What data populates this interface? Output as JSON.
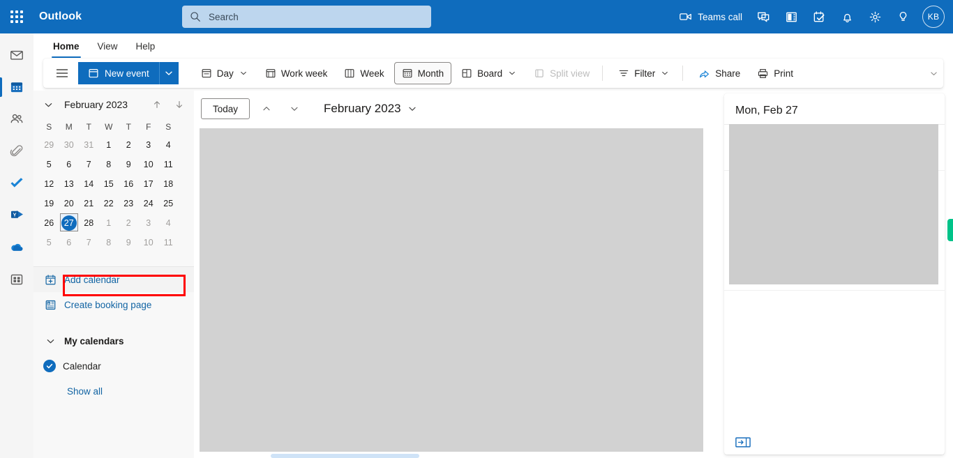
{
  "topbar": {
    "brand": "Outlook",
    "waffle_name": "app-launcher",
    "search": {
      "placeholder": "Search",
      "value": ""
    },
    "teams_call_label": "Teams call",
    "icons": [
      "video-camera-icon",
      "chat-icon",
      "skype-icon",
      "tasks-icon",
      "bell-icon",
      "gear-icon",
      "lightbulb-icon"
    ],
    "avatar_initials": "KB",
    "background_color": "#0f6cbd",
    "search_background": "#bdd6ee"
  },
  "rail": {
    "items": [
      {
        "name": "mail-icon",
        "label": "Mail",
        "selected": false
      },
      {
        "name": "calendar-icon",
        "label": "Calendar",
        "selected": true
      },
      {
        "name": "people-icon",
        "label": "People",
        "selected": false
      },
      {
        "name": "files-icon",
        "label": "Files",
        "selected": false
      },
      {
        "name": "to-do-icon",
        "label": "To Do",
        "selected": false
      },
      {
        "name": "yammer-icon",
        "label": "Yammer",
        "selected": false
      },
      {
        "name": "onedrive-icon",
        "label": "OneDrive",
        "selected": false
      },
      {
        "name": "apps-icon",
        "label": "Apps",
        "selected": false
      }
    ],
    "accent_color": "#0f6cbd"
  },
  "ribbon": {
    "tabs": [
      {
        "label": "Home",
        "active": true
      },
      {
        "label": "View",
        "active": false
      },
      {
        "label": "Help",
        "active": false
      }
    ],
    "overflow_icon": "chevron-down-icon"
  },
  "toolbar": {
    "hamburger_icon": "hamburger-icon",
    "new_event_label": "New event",
    "new_event_icon": "calendar-blank-icon",
    "new_event_caret_icon": "chevron-down-icon",
    "buttons": [
      {
        "label": "Day",
        "icon": "day-view-icon",
        "caret": true,
        "selected": false,
        "disabled": false
      },
      {
        "label": "Work week",
        "icon": "work-week-icon",
        "caret": false,
        "selected": false,
        "disabled": false
      },
      {
        "label": "Week",
        "icon": "week-view-icon",
        "caret": false,
        "selected": false,
        "disabled": false
      },
      {
        "label": "Month",
        "icon": "month-view-icon",
        "caret": false,
        "selected": true,
        "disabled": false
      },
      {
        "label": "Board",
        "icon": "board-view-icon",
        "caret": true,
        "selected": false,
        "disabled": false
      },
      {
        "label": "Split view",
        "icon": "split-view-icon",
        "caret": false,
        "selected": false,
        "disabled": true
      },
      {
        "label": "Filter",
        "icon": "filter-icon",
        "caret": true,
        "selected": false,
        "disabled": false
      },
      {
        "label": "Share",
        "icon": "share-icon",
        "caret": false,
        "selected": false,
        "disabled": false
      },
      {
        "label": "Print",
        "icon": "print-icon",
        "caret": false,
        "selected": false,
        "disabled": false
      }
    ]
  },
  "mini_calendar": {
    "collapse_icon": "chevron-down-icon",
    "title": "February 2023",
    "prev_icon": "arrow-up-icon",
    "next_icon": "arrow-down-icon",
    "day_headers": [
      "S",
      "M",
      "T",
      "W",
      "T",
      "F",
      "S"
    ],
    "weeks": [
      [
        {
          "d": "29",
          "muted": true
        },
        {
          "d": "30",
          "muted": true
        },
        {
          "d": "31",
          "muted": true
        },
        {
          "d": "1",
          "muted": false
        },
        {
          "d": "2",
          "muted": false
        },
        {
          "d": "3",
          "muted": false
        },
        {
          "d": "4",
          "muted": false
        }
      ],
      [
        {
          "d": "5",
          "muted": false
        },
        {
          "d": "6",
          "muted": false
        },
        {
          "d": "7",
          "muted": false
        },
        {
          "d": "8",
          "muted": false
        },
        {
          "d": "9",
          "muted": false
        },
        {
          "d": "10",
          "muted": false
        },
        {
          "d": "11",
          "muted": false
        }
      ],
      [
        {
          "d": "12",
          "muted": false
        },
        {
          "d": "13",
          "muted": false
        },
        {
          "d": "14",
          "muted": false
        },
        {
          "d": "15",
          "muted": false
        },
        {
          "d": "16",
          "muted": false
        },
        {
          "d": "17",
          "muted": false
        },
        {
          "d": "18",
          "muted": false
        }
      ],
      [
        {
          "d": "19",
          "muted": false
        },
        {
          "d": "20",
          "muted": false
        },
        {
          "d": "21",
          "muted": false
        },
        {
          "d": "22",
          "muted": false
        },
        {
          "d": "23",
          "muted": false
        },
        {
          "d": "24",
          "muted": false
        },
        {
          "d": "25",
          "muted": false
        }
      ],
      [
        {
          "d": "26",
          "muted": false
        },
        {
          "d": "27",
          "muted": false,
          "today": true
        },
        {
          "d": "28",
          "muted": false
        },
        {
          "d": "1",
          "muted": true
        },
        {
          "d": "2",
          "muted": true
        },
        {
          "d": "3",
          "muted": true
        },
        {
          "d": "4",
          "muted": true
        }
      ],
      [
        {
          "d": "5",
          "muted": true
        },
        {
          "d": "6",
          "muted": true
        },
        {
          "d": "7",
          "muted": true
        },
        {
          "d": "8",
          "muted": true
        },
        {
          "d": "9",
          "muted": true
        },
        {
          "d": "10",
          "muted": true
        },
        {
          "d": "11",
          "muted": true
        }
      ]
    ],
    "selected_day": "27",
    "selected_color": "#0f6cbd"
  },
  "sidebar": {
    "add_calendar": {
      "label": "Add calendar",
      "icon": "add-calendar-icon",
      "highlighted": true,
      "highlight_color": "#ff0000"
    },
    "create_booking": {
      "label": "Create booking page",
      "icon": "bookings-icon"
    },
    "my_calendars": {
      "label": "My calendars",
      "chevron_icon": "chevron-down-icon"
    },
    "calendar_item": {
      "label": "Calendar",
      "checked": true,
      "check_color": "#0f6cbd"
    },
    "show_all": {
      "label": "Show all"
    },
    "link_color": "#1264a3"
  },
  "calendar_header": {
    "today_label": "Today",
    "prev_icon": "chevron-up-icon",
    "next_icon": "chevron-down-icon",
    "month_label": "February 2023",
    "month_caret_icon": "chevron-down-icon"
  },
  "right_panel": {
    "title": "Mon, Feb 27",
    "footer_icon": "expand-panel-icon",
    "green_tab_color": "#00c389"
  }
}
